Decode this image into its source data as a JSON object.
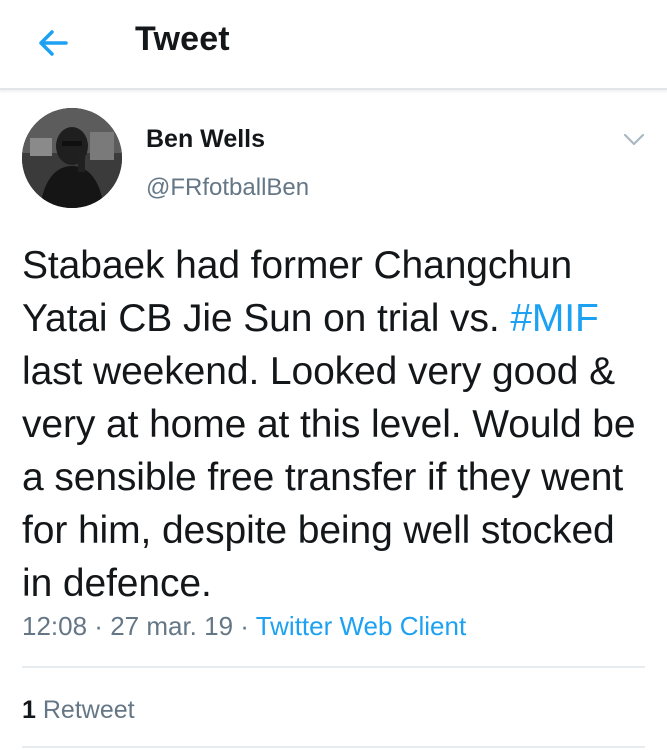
{
  "header": {
    "title": "Tweet",
    "back_icon": "back-arrow-icon"
  },
  "author": {
    "name": "Ben Wells",
    "handle": "@FRfotballBen",
    "menu_icon": "chevron-down-icon"
  },
  "tweet": {
    "text_before": "Stabaek had former Changchun Yatai CB Jie Sun on trial vs. ",
    "hashtag": "#MIF",
    "text_after": " last weekend. Looked very good & very at home at this level. Would be a sensible free transfer if they went for him, despite being well stocked in defence."
  },
  "meta": {
    "time": "12:08",
    "separator": " · ",
    "date": "27 mar. 19",
    "client": "Twitter Web Client"
  },
  "stats": {
    "retweet_count": "1",
    "retweet_label": "Retweet"
  },
  "colors": {
    "accent": "#1da1f2",
    "muted": "#657786",
    "text": "#14171a",
    "divider": "#e6ecf0"
  }
}
